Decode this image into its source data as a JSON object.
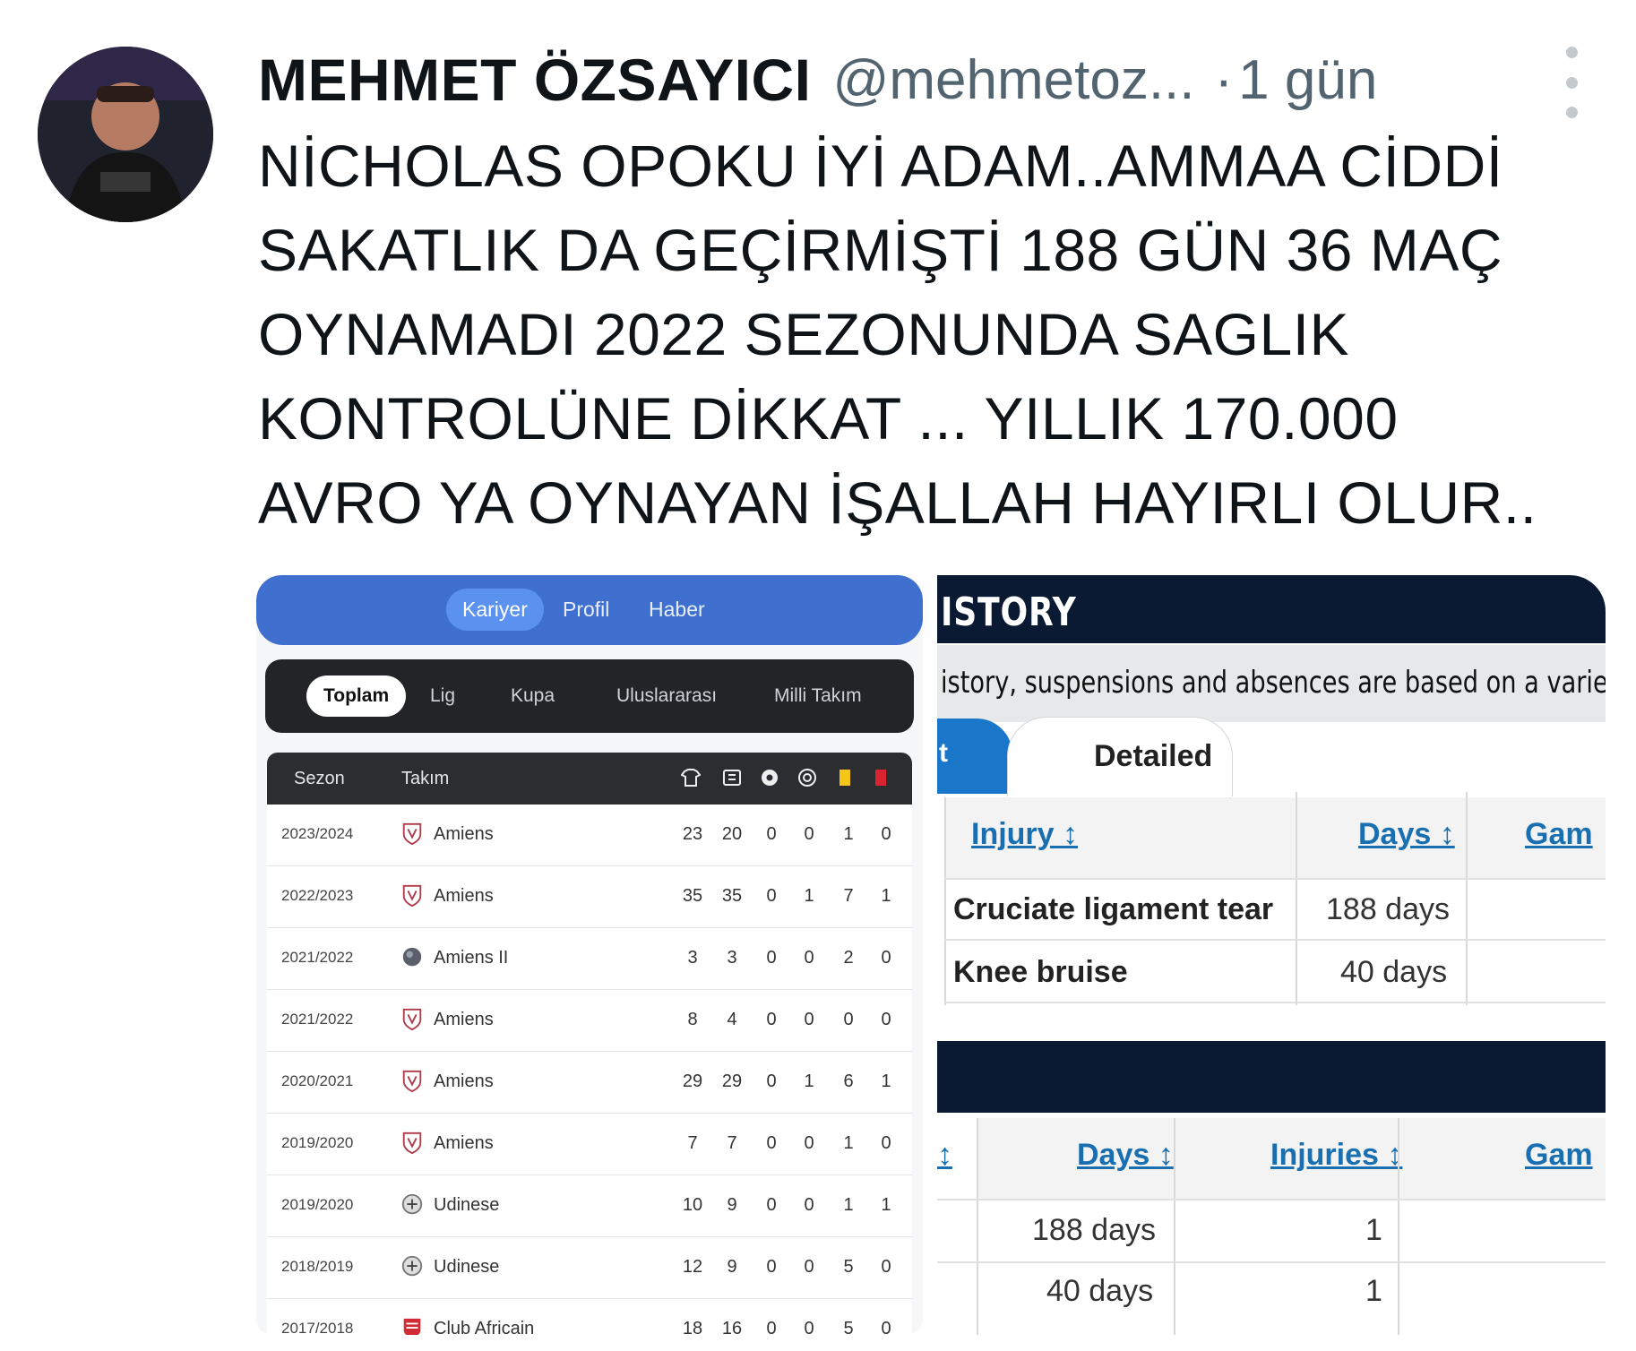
{
  "tweet": {
    "author_name": "MEHMET ÖZSAYICI",
    "handle": "@mehmetoz...",
    "separator": "·",
    "time": "1 gün",
    "text_lines": [
      "NİCHOLAS OPOKU İYİ ADAM..AMMAA CİDDİ",
      "SAKATLIK DA GEÇİRMİŞTİ  188 GÜN 36 MAÇ",
      "OYNAMADI 2022 SEZONUNDA SAGLIK",
      "KONTROLÜNE DİKKAT ... YILLIK 170.000",
      "AVRO YA OYNAYAN  İŞALLAH HAYIRLI OLUR.."
    ]
  },
  "career": {
    "top_tabs": [
      "Kariyer",
      "Profil",
      "Haber"
    ],
    "filters": [
      "Toplam",
      "Lig",
      "Kupa",
      "Uluslararası",
      "Milli Takım"
    ],
    "header": {
      "season": "Sezon",
      "team": "Takım"
    },
    "header_icons": [
      "shirt-icon",
      "bench-icon",
      "ball-icon",
      "assist-icon",
      "yellow-card-icon",
      "red-card-icon"
    ],
    "rows": [
      {
        "season": "2023/2024",
        "team": "Amiens",
        "logo": "amiens",
        "stats": [
          "23",
          "20",
          "0",
          "0",
          "1",
          "0"
        ]
      },
      {
        "season": "2022/2023",
        "team": "Amiens",
        "logo": "amiens",
        "stats": [
          "35",
          "35",
          "0",
          "1",
          "7",
          "1"
        ]
      },
      {
        "season": "2021/2022",
        "team": "Amiens II",
        "logo": "amiens2",
        "stats": [
          "3",
          "3",
          "0",
          "0",
          "2",
          "0"
        ]
      },
      {
        "season": "2021/2022",
        "team": "Amiens",
        "logo": "amiens",
        "stats": [
          "8",
          "4",
          "0",
          "0",
          "0",
          "0"
        ]
      },
      {
        "season": "2020/2021",
        "team": "Amiens",
        "logo": "amiens",
        "stats": [
          "29",
          "29",
          "0",
          "1",
          "6",
          "1"
        ]
      },
      {
        "season": "2019/2020",
        "team": "Amiens",
        "logo": "amiens",
        "stats": [
          "7",
          "7",
          "0",
          "0",
          "1",
          "0"
        ]
      },
      {
        "season": "2019/2020",
        "team": "Udinese",
        "logo": "udinese",
        "stats": [
          "10",
          "9",
          "0",
          "0",
          "1",
          "1"
        ]
      },
      {
        "season": "2018/2019",
        "team": "Udinese",
        "logo": "udinese",
        "stats": [
          "12",
          "9",
          "0",
          "0",
          "5",
          "0"
        ]
      },
      {
        "season": "2017/2018",
        "team": "Club Africain",
        "logo": "clubafricain",
        "stats": [
          "18",
          "16",
          "0",
          "0",
          "5",
          "0"
        ]
      }
    ]
  },
  "injury": {
    "title": "ISTORY",
    "description": "istory, suspensions and absences are based on a variety of",
    "tab_partial": "t",
    "tab_detailed": "Detailed",
    "detail_headers": {
      "injury": "Injury ↕",
      "days": "Days ↕",
      "games": "Gam"
    },
    "detail_rows": [
      {
        "injury": "Cruciate ligament tear",
        "days": "188 days"
      },
      {
        "injury": "Knee bruise",
        "days": "40 days"
      }
    ],
    "summary_headers": {
      "partial": "↕",
      "days": "Days ↕",
      "injuries": "Injuries ↕",
      "games": "Gam"
    },
    "summary_rows": [
      {
        "days": "188 days",
        "injuries": "1"
      },
      {
        "days": "40 days",
        "injuries": "1"
      }
    ]
  }
}
